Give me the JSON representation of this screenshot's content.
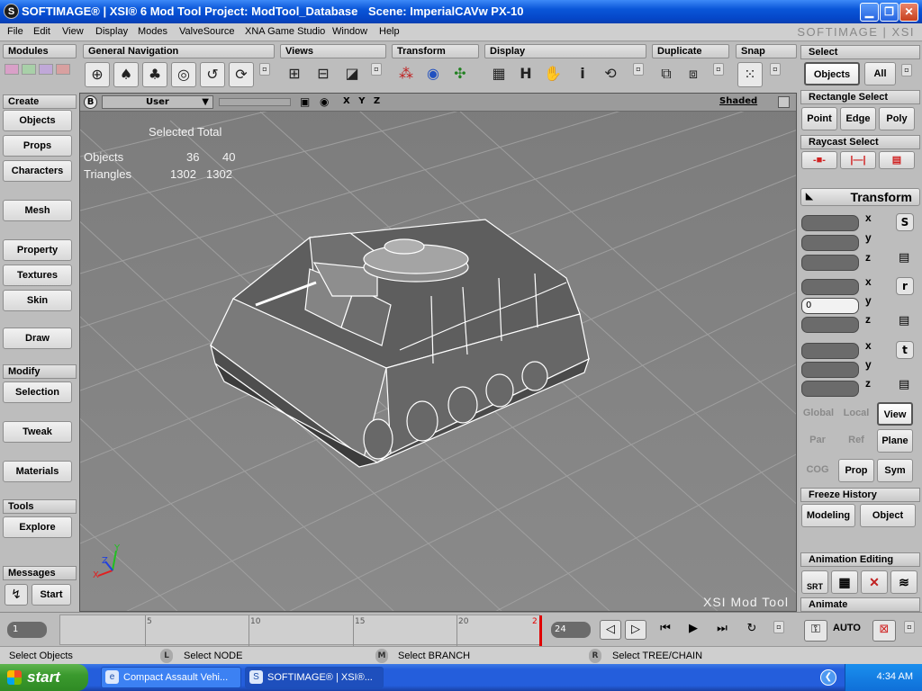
{
  "window": {
    "app_icon": "S",
    "title": "SOFTIMAGE® | XSI® 6 Mod Tool Project: ModTool_Database",
    "scene": "Scene: ImperialCAVw PX-10"
  },
  "menu": {
    "items": [
      "File",
      "Edit",
      "View",
      "Display",
      "Modes",
      "ValveSource",
      "XNA Game Studio",
      "Window",
      "Help"
    ],
    "brand": "SOFTIMAGE | XSI"
  },
  "toolbar": {
    "modules": "Modules",
    "general_navigation": "General Navigation",
    "views": "Views",
    "transform": "Transform",
    "display": "Display",
    "duplicate": "Duplicate",
    "snap": "Snap"
  },
  "left": {
    "create": "Create",
    "objects": "Objects",
    "props": "Props",
    "characters": "Characters",
    "mesh": "Mesh",
    "property": "Property",
    "textures": "Textures",
    "skin": "Skin",
    "draw": "Draw",
    "modify": "Modify",
    "selection": "Selection",
    "tweak": "Tweak",
    "materials": "Materials",
    "tools": "Tools",
    "explore": "Explore",
    "messages": "Messages",
    "start": "Start"
  },
  "viewport": {
    "badge": "B",
    "camera": "User",
    "axes": "X Y Z",
    "shading": "Shaded",
    "stats": {
      "header": "Selected Total",
      "objects_label": "Objects",
      "objects_selected": "36",
      "objects_total": "40",
      "triangles_label": "Triangles",
      "triangles_selected": "1302",
      "triangles_total": "1302"
    },
    "watermark": "XSI Mod Tool"
  },
  "right": {
    "select": "Select",
    "objects": "Objects",
    "all": "All",
    "rectangle_select": "Rectangle Select",
    "point": "Point",
    "edge": "Edge",
    "poly": "Poly",
    "raycast_select": "Raycast Select",
    "transform": "Transform",
    "x": "x",
    "y": "y",
    "z": "z",
    "s": "S",
    "r": "r",
    "t": "t",
    "rot_y_value": "0",
    "global": "Global",
    "local": "Local",
    "view": "View",
    "par": "Par",
    "ref": "Ref",
    "plane": "Plane",
    "cog": "COG",
    "prop": "Prop",
    "sym": "Sym",
    "freeze_history": "Freeze History",
    "modeling": "Modeling",
    "object": "Object",
    "animation_editing": "Animation Editing",
    "srt": "SRT",
    "animate": "Animate",
    "auto": "AUTO"
  },
  "timeline": {
    "current_frame": "1",
    "end_frame": "24",
    "ticks": [
      "5",
      "10",
      "15",
      "20",
      "2"
    ]
  },
  "status": {
    "left_hint": "Select Objects",
    "l_key": "L",
    "l_hint": "Select NODE",
    "m_key": "M",
    "m_hint": "Select BRANCH",
    "r_key": "R",
    "r_hint": "Select TREE/CHAIN"
  },
  "taskbar": {
    "start": "start",
    "item1": "Compact Assault Vehi...",
    "item2": "SOFTIMAGE® | XSI®...",
    "clock": "4:34 AM"
  },
  "colors": {
    "viewport_bg": "#808080",
    "title_blue": "#0a56d8",
    "playhead": "#e00000"
  }
}
